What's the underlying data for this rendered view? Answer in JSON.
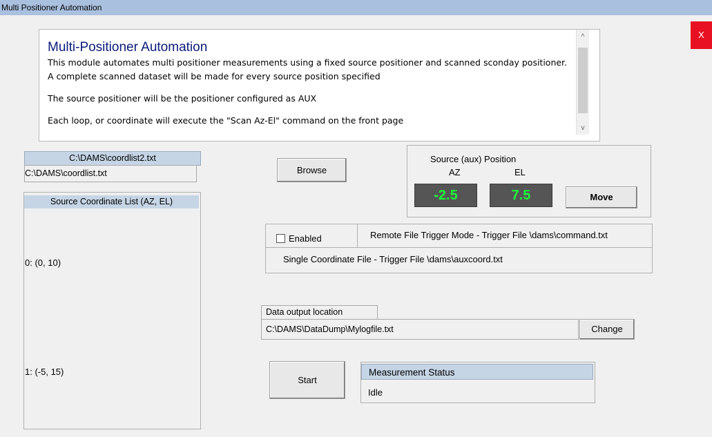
{
  "window": {
    "title": "Multi Positioner Automation",
    "close_label": "X"
  },
  "info": {
    "heading": "Multi-Positioner Automation",
    "paragraphs": [
      "This module automates multi positioner measurements using a fixed source positioner and scanned sconday positioner. A complete scanned dataset will be made for every source position specified",
      "The source positioner will be the positioner configured as AUX",
      "Each loop, or coordinate will execute the \"Scan Az-El\" command on the front page"
    ],
    "scroll_up": "^",
    "scroll_down": "v"
  },
  "file": {
    "header": "C:\\DAMS\\coordlist2.txt",
    "path": "C:\\DAMS\\coordlist.txt",
    "browse_label": "Browse"
  },
  "coord_list": {
    "header": "Source Coordinate List (AZ, EL)",
    "items": [
      "0: (0, 10)",
      "1: (-5, 15)"
    ]
  },
  "source_position": {
    "title": "Source (aux) Position",
    "az_label": "AZ",
    "el_label": "EL",
    "az_value": "-2.5",
    "el_value": "7.5",
    "move_label": "Move"
  },
  "trigger": {
    "enabled_label": "Enabled",
    "enabled": false,
    "remote_mode_label": "Remote File Trigger Mode - Trigger File \\dams\\command.txt",
    "single_coord_label": "Single Coordinate File - Trigger File \\dams\\auxcoord.txt"
  },
  "output": {
    "header": "Data output location",
    "path": "C:\\DAMS\\DataDump\\Mylogfile.txt",
    "change_label": "Change"
  },
  "start_label": "Start",
  "status": {
    "header": "Measurement Status",
    "value": "Idle"
  },
  "colors": {
    "titlebar": "#a9c0de",
    "close_button": "#e81123",
    "led_background": "#555555",
    "led_text": "#1dff3a",
    "header_fill": "#c5d5e5"
  }
}
